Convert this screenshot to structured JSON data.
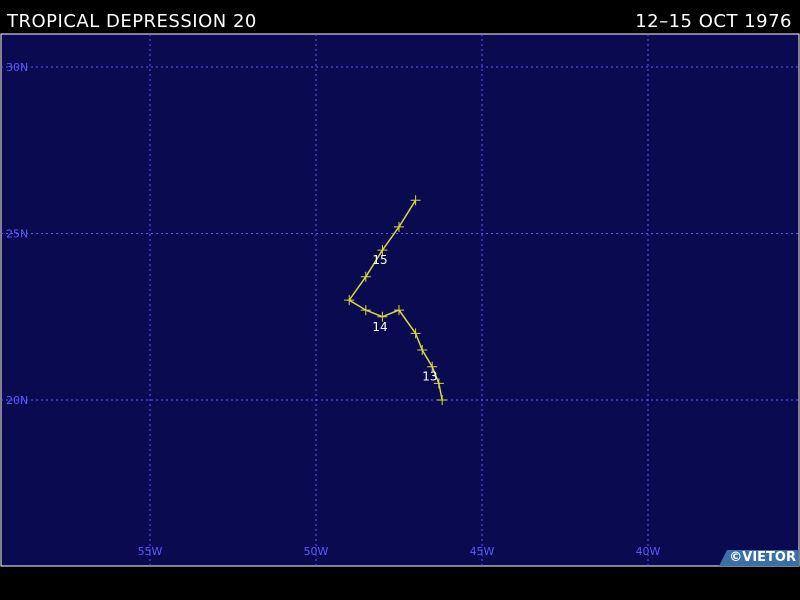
{
  "header": {
    "storm_name": "TROPICAL DEPRESSION 20",
    "dates": "12–15 OCT 1976"
  },
  "map": {
    "background_color": "#0a0a50",
    "grid_color": "#5a5aff",
    "track_color": "#d8d840",
    "lat_labels": [
      "30N",
      "25N",
      "20N"
    ],
    "lon_labels": [
      "55W",
      "50W",
      "45W",
      "40W"
    ],
    "lat_values": [
      30,
      25,
      20
    ],
    "lon_values": [
      55,
      50,
      45,
      40
    ]
  },
  "track": {
    "points": [
      {
        "lat": 20.0,
        "lon": 46.2
      },
      {
        "lat": 20.5,
        "lon": 46.3
      },
      {
        "lat": 21.0,
        "lon": 46.5
      },
      {
        "lat": 21.5,
        "lon": 46.8
      },
      {
        "lat": 22.0,
        "lon": 47.0
      },
      {
        "lat": 22.7,
        "lon": 47.5
      },
      {
        "lat": 22.5,
        "lon": 48.0
      },
      {
        "lat": 22.7,
        "lon": 48.5
      },
      {
        "lat": 23.0,
        "lon": 49.0
      },
      {
        "lat": 23.7,
        "lon": 48.5
      },
      {
        "lat": 24.5,
        "lon": 48.0
      },
      {
        "lat": 25.2,
        "lon": 47.5
      },
      {
        "lat": 26.0,
        "lon": 47.0
      }
    ],
    "day_labels": [
      {
        "text": "13",
        "lat": 21.0,
        "lon": 46.5
      },
      {
        "text": "14",
        "lat": 22.5,
        "lon": 48.0
      },
      {
        "text": "15",
        "lat": 24.5,
        "lon": 48.0
      }
    ]
  },
  "credit": "©VIETOR"
}
